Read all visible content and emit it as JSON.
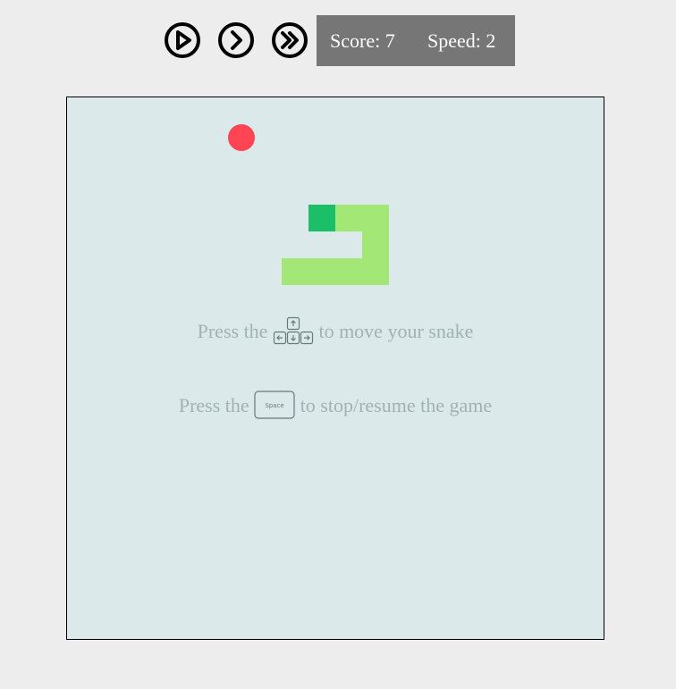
{
  "controls": {
    "play": "play-icon",
    "next": "chevron-right-icon",
    "fast_forward": "fast-forward-icon"
  },
  "status": {
    "score": "Score: 7",
    "speed": "Speed: 2"
  },
  "game": {
    "snake_head_color": "#1bbf67",
    "snake_body_color": "#a3e877",
    "food_color": "#ff4553",
    "board_color": "#dbe9ea"
  },
  "hints": {
    "move_prefix": "Press the",
    "move_suffix": "to move your snake",
    "move_icon": "arrow-keys-icon",
    "pause_prefix": "Press the",
    "pause_key": "Space",
    "pause_suffix": "to stop/resume the game"
  }
}
